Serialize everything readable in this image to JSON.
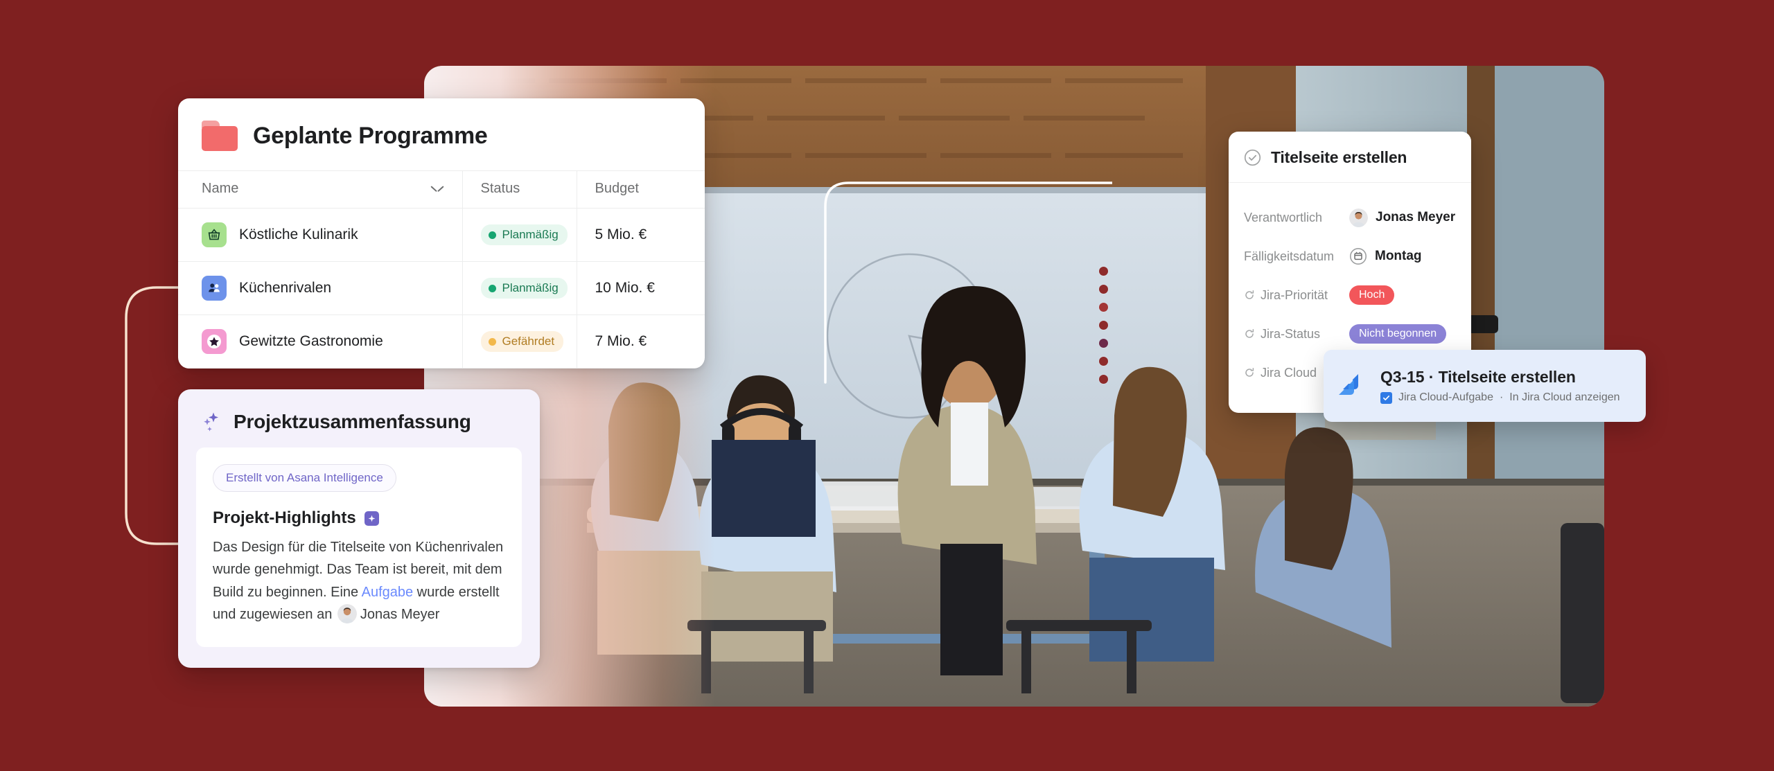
{
  "background_color": "#7f2020",
  "programs_card": {
    "title": "Geplante Programme",
    "folder_icon": "folder-icon",
    "columns": [
      "Name",
      "Status",
      "Budget"
    ],
    "rows": [
      {
        "icon": "basket-icon",
        "icon_bg": "#a7e08e",
        "name": "Köstliche Kulinarik",
        "status": "Planmäßig",
        "status_kind": "ontrack",
        "budget": "5 Mio. €"
      },
      {
        "icon": "people-icon",
        "icon_bg": "#6d92ea",
        "name": "Küchenrivalen",
        "status": "Planmäßig",
        "status_kind": "ontrack",
        "budget": "10 Mio. €"
      },
      {
        "icon": "star-icon",
        "icon_bg": "#f49ad0",
        "name": "Gewitzte Gastronomie",
        "status": "Gefährdet",
        "status_kind": "atrisk",
        "budget": "7 Mio. €"
      }
    ]
  },
  "summary_card": {
    "title": "Projektzusammenfassung",
    "badge": "Erstellt von Asana Intelligence",
    "subheading": "Projekt-Highlights",
    "text_part1": "Das Design für die Titelseite von Küchenrivalen wurde genehmigt. Das Team ist bereit, mit dem Build zu beginnen. Eine ",
    "link_text": "Aufgabe",
    "text_part2": " wurde erstellt und zugewiesen an ",
    "assignee": "Jonas Meyer"
  },
  "task_card": {
    "title": "Titelseite erstellen",
    "fields": [
      {
        "label": "Verantwortlich",
        "value": "Jonas Meyer",
        "type": "avatar"
      },
      {
        "label": "Fälligkeitsdatum",
        "value": "Montag",
        "type": "date"
      },
      {
        "label": "Jira-Priorität",
        "value": "Hoch",
        "type": "tag-high"
      },
      {
        "label": "Jira-Status",
        "value": "Nicht begonnen",
        "type": "tag-notstarted"
      },
      {
        "label": "Jira Cloud",
        "value": "",
        "type": "none"
      }
    ]
  },
  "jira_popup": {
    "title": "Q3-15 · Titelseite erstellen",
    "subtitle_task": "Jira Cloud-Aufgabe",
    "subtitle_sep": "·",
    "subtitle_link": "In Jira Cloud anzeigen"
  },
  "colors": {
    "accent_red": "#f26b6b",
    "ontrack_green": "#17a571",
    "atrisk_amber": "#f2b84b",
    "ai_purple": "#6f65c7",
    "jira_blue": "#2f7ae5",
    "high_red": "#f2565a",
    "notstarted_purple": "#8b82d6"
  }
}
